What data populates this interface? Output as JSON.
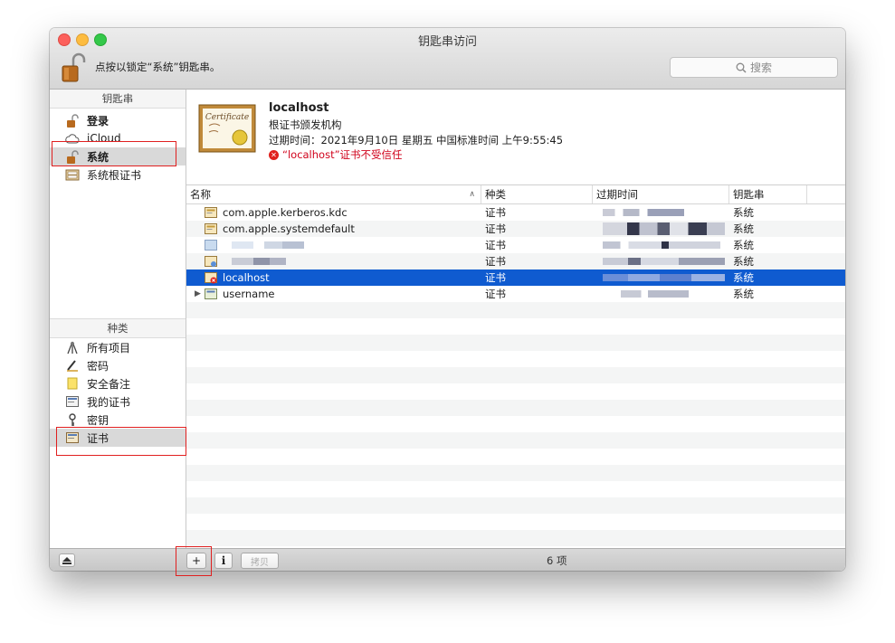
{
  "window": {
    "title": "钥匙串访问"
  },
  "toolbar": {
    "lock_text": "点按以锁定“系统”钥匙串。",
    "search_placeholder": "搜索"
  },
  "sidebar": {
    "keychains_header": "钥匙串",
    "keychains": [
      {
        "label": "登录",
        "icon": "lock-icon",
        "bold": true
      },
      {
        "label": "iCloud",
        "icon": "cloud-icon"
      },
      {
        "label": "系统",
        "icon": "lock-icon",
        "bold": true,
        "selected": true
      },
      {
        "label": "系统根证书",
        "icon": "cabinet-icon"
      }
    ],
    "category_header": "种类",
    "categories": [
      {
        "label": "所有项目",
        "icon": "keys-icon"
      },
      {
        "label": "密码",
        "icon": "pencil-icon"
      },
      {
        "label": "安全备注",
        "icon": "note-icon"
      },
      {
        "label": "我的证书",
        "icon": "certificate-icon"
      },
      {
        "label": "密钥",
        "icon": "key-icon"
      },
      {
        "label": "证书",
        "icon": "certificate-icon",
        "selected": true
      }
    ]
  },
  "detail": {
    "name": "localhost",
    "issuer": "根证书颁发机构",
    "expiry": "过期时间：2021年9月10日 星期五 中国标准时间 上午9:55:45",
    "trust_warning": "“localhost”证书不受信任",
    "cert_badge_text": "Certificate"
  },
  "table": {
    "headers": {
      "name": "名称",
      "kind": "种类",
      "expires": "过期时间",
      "keychain": "钥匙串"
    },
    "rows": [
      {
        "name": "com.apple.kerberos.kdc",
        "kind": "证书",
        "keychain": "系统"
      },
      {
        "name": "com.apple.systemdefault",
        "kind": "证书",
        "keychain": "系统"
      },
      {
        "name": "",
        "kind": "证书",
        "keychain": "系统"
      },
      {
        "name": "",
        "kind": "证书",
        "keychain": "系统"
      },
      {
        "name": "localhost",
        "kind": "证书",
        "keychain": "系统",
        "selected": true
      },
      {
        "name": "username",
        "kind": "证书",
        "keychain": "系统"
      }
    ]
  },
  "bottombar": {
    "add_label": "+",
    "info_label": "i",
    "copy_label": "拷贝",
    "count_label": "6 项"
  },
  "colors": {
    "selection": "#0f5bd0",
    "warning": "#e0211d",
    "annotation": "#e02020"
  }
}
